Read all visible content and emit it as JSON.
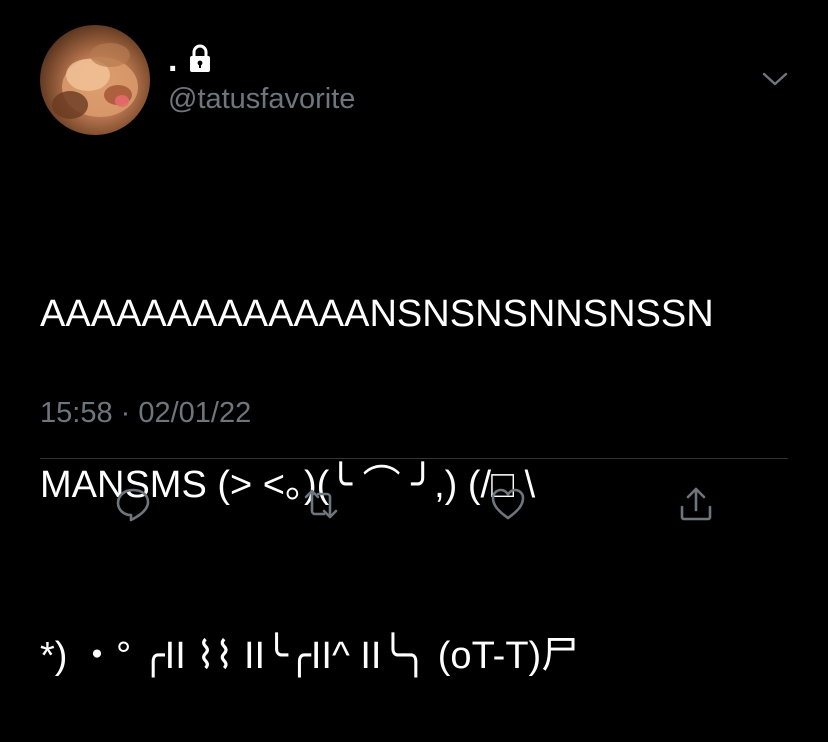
{
  "user": {
    "display_name": ".",
    "handle": "@tatusfavorite"
  },
  "tweet": {
    "lines": [
      "AAAAAAAAAAAAANSNSNSNNSNSSN",
      "MANSMS (> <。)(╰ ⌒ ╯,) (/□ \\",
      "*) ・° ╭ΙΙ ⌇⌇ ΙΙ╰╭ΙΙ^ ΙΙ╰╮ (oT-T)尸"
    ]
  },
  "meta": {
    "timestamp": "15:58 · 02/01/22"
  },
  "actions": {
    "reply": "reply-icon",
    "retweet": "retweet-icon",
    "like": "heart-icon",
    "share": "share-icon"
  },
  "colors": {
    "background": "#000000",
    "text": "#ffffff",
    "secondary": "#6e767d",
    "divider": "#2f3336"
  }
}
